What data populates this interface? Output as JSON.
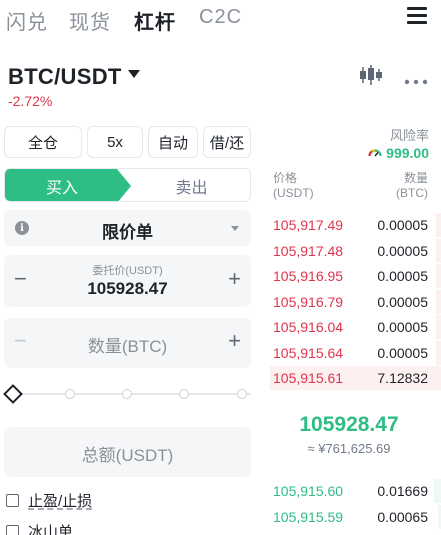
{
  "tabs": [
    {
      "label": "闪兑",
      "active": false
    },
    {
      "label": "现货",
      "active": false
    },
    {
      "label": "杠杆",
      "active": true
    },
    {
      "label": "C2C",
      "active": false
    }
  ],
  "pair": {
    "symbol": "BTC/USDT",
    "change": "-2.72%"
  },
  "options": {
    "margin_mode": "全仓",
    "leverage": "5x",
    "auto": "自动",
    "borrow_repay": "借/还"
  },
  "risk": {
    "label": "风险率",
    "value": "999.00"
  },
  "side": {
    "buy": "买入",
    "sell": "卖出",
    "selected": "buy"
  },
  "order_type": {
    "label": "限价单"
  },
  "price_field": {
    "caption": "委托价(USDT)",
    "value": "105928.47",
    "minus": "−",
    "plus": "+"
  },
  "qty_field": {
    "placeholder": "数量(BTC)",
    "minus": "−",
    "plus": "+"
  },
  "slider": {
    "value_percent": 0
  },
  "total_field": {
    "placeholder": "总额(USDT)"
  },
  "checkboxes": {
    "tp_sl": "止盈/止损",
    "iceberg": "冰山单"
  },
  "orderbook": {
    "price_header_line1": "价格",
    "price_header_line2": "(USDT)",
    "qty_header_line1": "数量",
    "qty_header_line2": "(BTC)",
    "asks": [
      {
        "price": "105,917.49",
        "qty": "0.00005",
        "depth": 0.03
      },
      {
        "price": "105,917.48",
        "qty": "0.00005",
        "depth": 0.03
      },
      {
        "price": "105,916.95",
        "qty": "0.00005",
        "depth": 0.03
      },
      {
        "price": "105,916.79",
        "qty": "0.00005",
        "depth": 0.03
      },
      {
        "price": "105,916.04",
        "qty": "0.00005",
        "depth": 0.03
      },
      {
        "price": "105,915.64",
        "qty": "0.00005",
        "depth": 0.03
      },
      {
        "price": "105,915.61",
        "qty": "7.12832",
        "depth": 1.0
      }
    ],
    "last_price": "105928.47",
    "last_price_fiat": "≈ ¥761,625.69",
    "bids": [
      {
        "price": "105,915.60",
        "qty": "0.01669",
        "depth": 0.04
      },
      {
        "price": "105,915.59",
        "qty": "0.00065",
        "depth": 0.02
      }
    ]
  },
  "colors": {
    "buy": "#2ebd85",
    "sell": "#e0344c",
    "text": "#1e2329",
    "muted": "#8a9199"
  },
  "icons": {
    "menu": "hamburger-menu-icon",
    "chart": "candlestick-chart-icon",
    "more": "more-dots-icon",
    "info": "info-icon",
    "risk": "gauge-icon",
    "pair_dropdown": "caret-down-icon"
  }
}
